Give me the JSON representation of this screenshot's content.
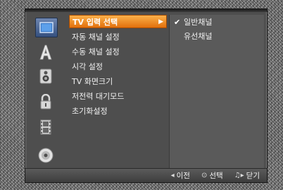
{
  "sidebar": {
    "icons": [
      {
        "name": "tv-input-icon",
        "selected": true
      },
      {
        "name": "language-icon",
        "selected": false
      },
      {
        "name": "audio-speaker-icon",
        "selected": false
      },
      {
        "name": "lock-icon",
        "selected": false
      },
      {
        "name": "film-icon",
        "selected": false
      },
      {
        "name": "disc-icon",
        "selected": false
      }
    ]
  },
  "menu": {
    "items": [
      {
        "label": "TV 입력 선택"
      },
      {
        "label": "자동 채널 설정"
      },
      {
        "label": "수동 채널 설정"
      },
      {
        "label": "시각 설정"
      },
      {
        "label": "TV 화면크기"
      },
      {
        "label": "저전력 대기모드"
      },
      {
        "label": "초기화설정"
      }
    ],
    "selected_index": 0
  },
  "submenu": {
    "items": [
      {
        "label": "일반채널",
        "checked": true,
        "check_glyph": "✔"
      },
      {
        "label": "유선채널",
        "checked": false,
        "check_glyph": ""
      }
    ]
  },
  "bottom_bar": {
    "back": {
      "glyph": "◂",
      "label": "이전"
    },
    "select": {
      "glyph": "⊙",
      "label": "선택"
    },
    "close": {
      "glyph": "♫▸",
      "label": "닫기"
    }
  },
  "colors": {
    "highlight_top": "#fbb04a",
    "highlight_bottom": "#e2700c",
    "panel": "#4e4e4e",
    "icon_selected": "#35507f"
  }
}
